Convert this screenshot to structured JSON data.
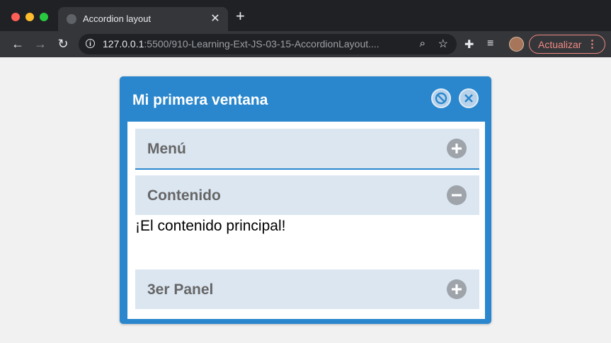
{
  "browser": {
    "tab_title": "Accordion layout",
    "new_tab_label": "+",
    "url_host": "127.0.0.1",
    "url_rest": ":5500/910-Learning-Ext-JS-03-15-AccordionLayout....",
    "update_label": "Actualizar"
  },
  "window": {
    "title": "Mi primera ventana",
    "accent_color": "#2a87cd"
  },
  "accordion": {
    "panels": [
      {
        "label": "Menú",
        "state": "collapsed",
        "toggle_icon": "plus-icon"
      },
      {
        "label": "Contenido",
        "state": "expanded",
        "toggle_icon": "minus-icon",
        "content": "¡El contenido principal!"
      },
      {
        "label": "3er Panel",
        "state": "collapsed",
        "toggle_icon": "plus-icon"
      }
    ]
  }
}
